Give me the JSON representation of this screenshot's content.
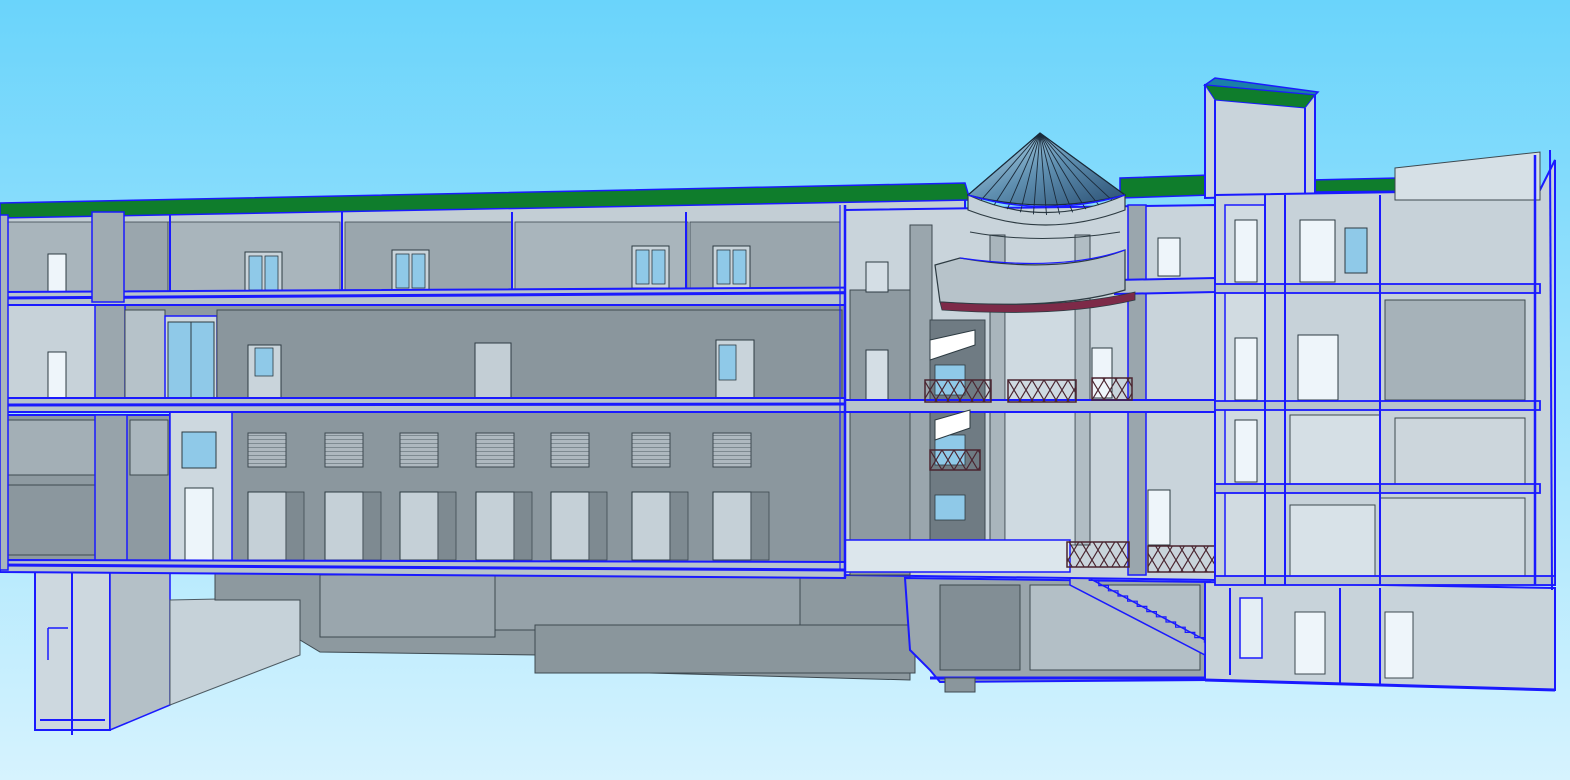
{
  "scene": {
    "type": "3d-building-section-view",
    "background_top": "#6fd6fb",
    "background_bottom": "#d8f4fe",
    "edge_color": "#1a1aff",
    "roof_color": "#0f7d2c",
    "wall_light": "#cdd8df",
    "wall_mid": "#9eaab2",
    "wall_dark": "#7c8890",
    "glass_color": "#8fc9e8",
    "railing_color": "#4a2530"
  },
  "components": [
    {
      "id": "flat-roof",
      "material": "green-roof"
    },
    {
      "id": "glass-dome",
      "material": "glazing"
    },
    {
      "id": "chimney-tower",
      "material": "concrete"
    },
    {
      "id": "upper-floor",
      "material": "concrete"
    },
    {
      "id": "middle-floor",
      "material": "concrete"
    },
    {
      "id": "ground-floor",
      "material": "concrete"
    },
    {
      "id": "basement",
      "material": "concrete"
    },
    {
      "id": "curved-balcony",
      "material": "concrete"
    },
    {
      "id": "stair-railings",
      "material": "timber"
    },
    {
      "id": "basement-stair",
      "material": "concrete"
    }
  ]
}
